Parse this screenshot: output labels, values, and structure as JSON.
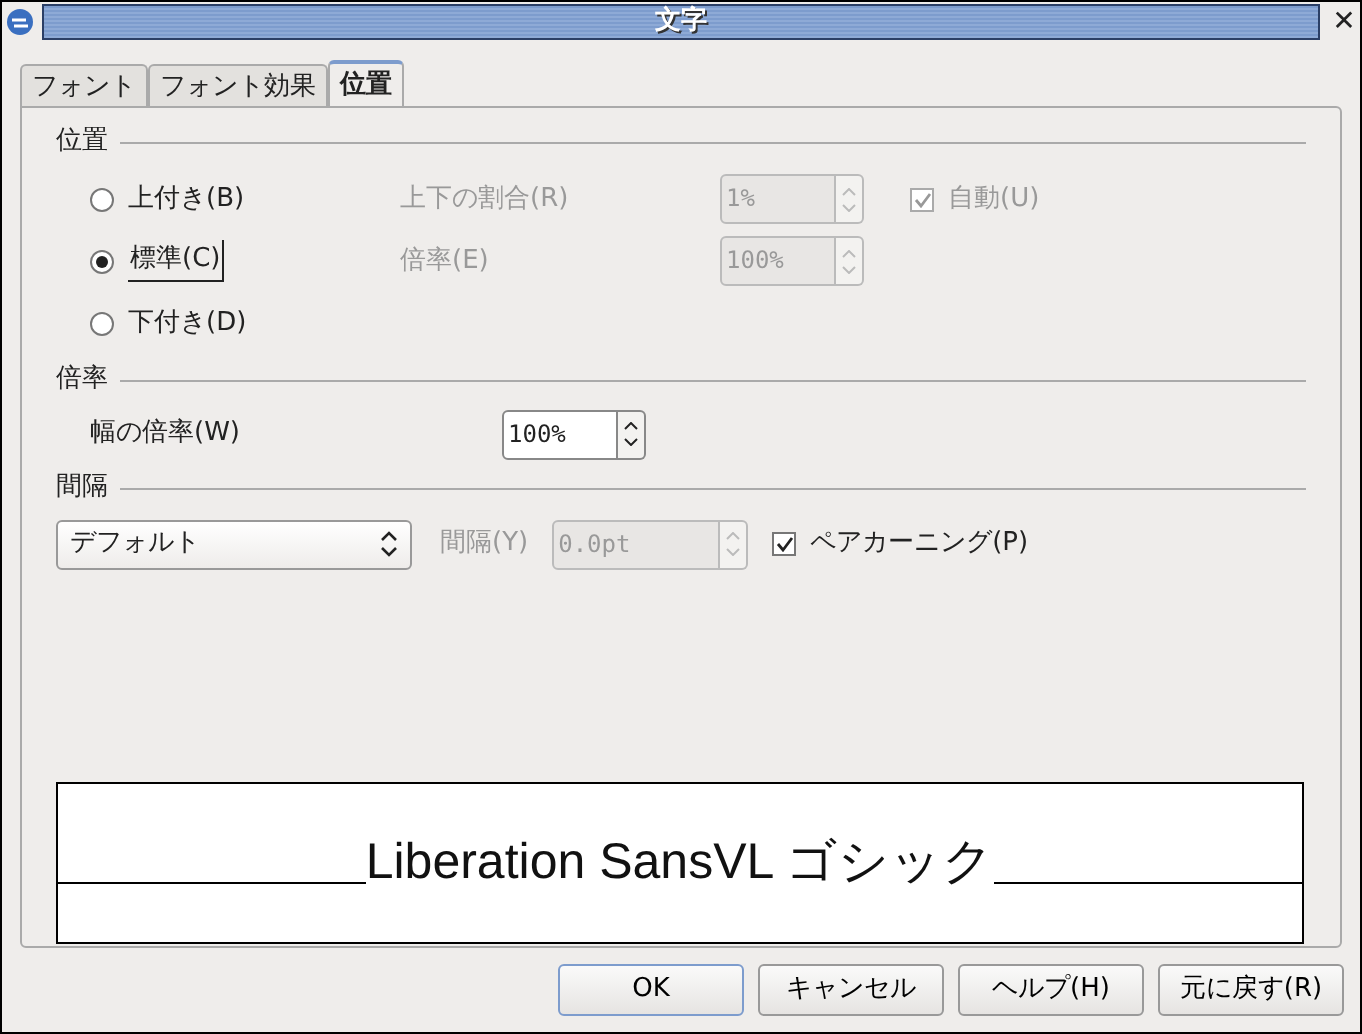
{
  "window": {
    "title": "文字",
    "close": "✕"
  },
  "tabs": [
    {
      "label": "フォント",
      "selected": false
    },
    {
      "label": "フォント効果",
      "selected": false
    },
    {
      "label": "位置",
      "selected": true
    }
  ],
  "position": {
    "heading": "位置",
    "options": [
      {
        "label": "上付き(B)",
        "selected": false
      },
      {
        "label": "標準(C)",
        "selected": true
      },
      {
        "label": "下付き(D)",
        "selected": false
      }
    ],
    "ratio": {
      "label": "上下の割合(R)",
      "value": "1%",
      "disabled": true
    },
    "scale": {
      "label": "倍率(E)",
      "value": "100%",
      "disabled": true
    },
    "auto": {
      "label": "自動(U)",
      "checked": true,
      "disabled": true
    }
  },
  "scaling": {
    "heading": "倍率",
    "width": {
      "label": "幅の倍率(W)",
      "value": "100%",
      "disabled": false
    }
  },
  "spacing": {
    "heading": "間隔",
    "mode": "デフォルト",
    "amount": {
      "label": "間隔(Y)",
      "value": "0.0pt",
      "disabled": true
    },
    "kerning": {
      "label": "ペアカーニング(P)",
      "checked": true,
      "disabled": false
    }
  },
  "preview": "Liberation SansVL ゴシック",
  "buttons": [
    {
      "label": "OK",
      "kind": "default"
    },
    {
      "label": "キャンセル",
      "kind": "normal"
    },
    {
      "label": "ヘルプ(H)",
      "kind": "normal"
    },
    {
      "label": "元に戻す(R)",
      "kind": "normal"
    }
  ]
}
